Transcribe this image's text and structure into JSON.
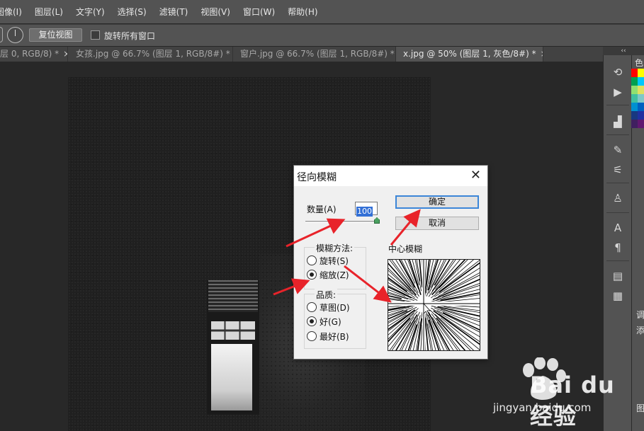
{
  "menu": [
    "图像(I)",
    "图层(L)",
    "文字(Y)",
    "选择(S)",
    "滤镜(T)",
    "视图(V)",
    "窗口(W)",
    "帮助(H)"
  ],
  "options": {
    "reset_view": "复位视图",
    "rotate_all": "旋转所有窗口"
  },
  "tabs": [
    {
      "label": "层 0, RGB/8) *",
      "close": "×"
    },
    {
      "label": "女孩.jpg @ 66.7% (图层 1, RGB/8#) *",
      "close": "×"
    },
    {
      "label": "窗户.jpg @ 66.7% (图层 1, RGB/8#) *",
      "close": "×"
    },
    {
      "label": "x.jpg @ 50% (图层 1, 灰色/8#) *",
      "close": "×"
    }
  ],
  "panels": {
    "collapse": "‹‹",
    "color_tab": "色",
    "adjust_tab": "调",
    "add_tab": "添",
    "layers_tab": "图"
  },
  "swatch_colors": [
    "#ff0000",
    "#ffff00",
    "#00a050",
    "#00c8ff",
    "#90e070",
    "#e0e060",
    "#40c0a0",
    "#80c8c8",
    "#0090d0",
    "#0060c0",
    "#183880",
    "#2030a0",
    "#402060",
    "#601870"
  ],
  "dialog": {
    "title": "径向模糊",
    "close": "✕",
    "amount_label": "数量(A)",
    "amount_value": "100",
    "ok": "确定",
    "cancel": "取消",
    "method_title": "模糊方法:",
    "method_options": [
      "旋转(S)",
      "缩放(Z)"
    ],
    "method_selected": "缩放(Z)",
    "quality_title": "品质:",
    "quality_options": [
      "草图(D)",
      "好(G)",
      "最好(B)"
    ],
    "quality_selected": "好(G)",
    "center_label": "中心模糊"
  },
  "annotation_color": "#e8232a",
  "watermark": {
    "brand": "Bai du 经验",
    "url": "jingyan.baidu.com"
  }
}
